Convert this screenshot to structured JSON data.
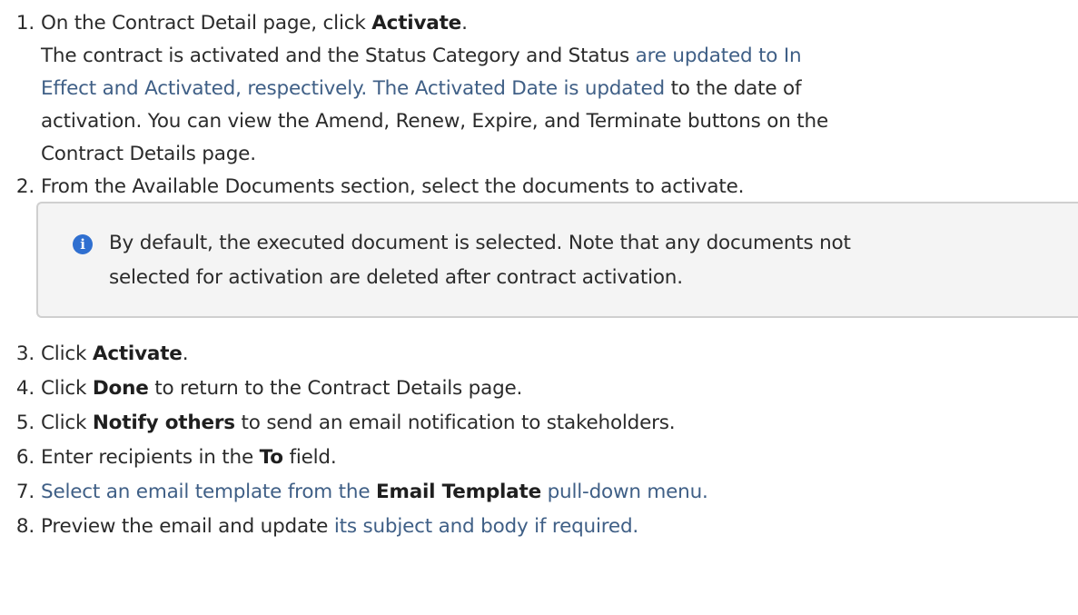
{
  "steps": [
    {
      "number": "1.",
      "lines": [
        {
          "segments": [
            {
              "text": "On the Contract Detail page, click ",
              "style": "normal"
            },
            {
              "text": "Activate",
              "style": "bold"
            },
            {
              "text": ".",
              "style": "normal"
            }
          ]
        },
        {
          "segments": [
            {
              "text": "The contract is activated and the Status Category and Status ",
              "style": "normal"
            },
            {
              "text": "are updated to In",
              "style": "highlight"
            }
          ]
        },
        {
          "segments": [
            {
              "text": "Effect and Activated, respectively. The Activated Date is updated",
              "style": "highlight"
            },
            {
              "text": " to the date of",
              "style": "normal"
            }
          ]
        },
        {
          "segments": [
            {
              "text": "activation. You can view the Amend, Renew, Expire, and Terminate buttons on the",
              "style": "normal"
            }
          ]
        },
        {
          "segments": [
            {
              "text": "Contract Details page.",
              "style": "normal"
            }
          ]
        }
      ]
    },
    {
      "number": "2.",
      "lines": [
        {
          "segments": [
            {
              "text": "From the Available Documents section, select the documents to activate.",
              "style": "normal"
            }
          ]
        }
      ]
    },
    {
      "number": "3.",
      "lines": [
        {
          "segments": [
            {
              "text": "Click ",
              "style": "normal"
            },
            {
              "text": "Activate",
              "style": "bold"
            },
            {
              "text": ".",
              "style": "normal"
            }
          ]
        }
      ]
    },
    {
      "number": "4.",
      "lines": [
        {
          "segments": [
            {
              "text": "Click ",
              "style": "normal"
            },
            {
              "text": "Done",
              "style": "bold"
            },
            {
              "text": " to return to the Contract Details page.",
              "style": "normal"
            }
          ]
        }
      ]
    },
    {
      "number": "5.",
      "lines": [
        {
          "segments": [
            {
              "text": "Click ",
              "style": "normal"
            },
            {
              "text": "Notify others",
              "style": "bold"
            },
            {
              "text": " to send an email notification to stakeholders.",
              "style": "normal"
            }
          ]
        }
      ]
    },
    {
      "number": "6.",
      "lines": [
        {
          "segments": [
            {
              "text": "Enter recipients in the ",
              "style": "normal"
            },
            {
              "text": "To",
              "style": "bold"
            },
            {
              "text": " field.",
              "style": "normal"
            }
          ]
        }
      ]
    },
    {
      "number": "7.",
      "lines": [
        {
          "segments": [
            {
              "text": "Select an email template from the ",
              "style": "highlight"
            },
            {
              "text": "Email Template",
              "style": "bold"
            },
            {
              "text": " pull-down menu.",
              "style": "highlight"
            }
          ]
        }
      ]
    },
    {
      "number": "8.",
      "lines": [
        {
          "segments": [
            {
              "text": "Preview the email and update ",
              "style": "normal"
            },
            {
              "text": "its subject and body if required.",
              "style": "highlight"
            }
          ]
        }
      ]
    }
  ],
  "note": {
    "icon": "info-icon",
    "glyph": "i",
    "icon_color": "#2f6fd0",
    "lines": [
      "By default, the executed document is selected. Note that any documents not",
      "selected for activation are deleted after contract activation."
    ]
  }
}
